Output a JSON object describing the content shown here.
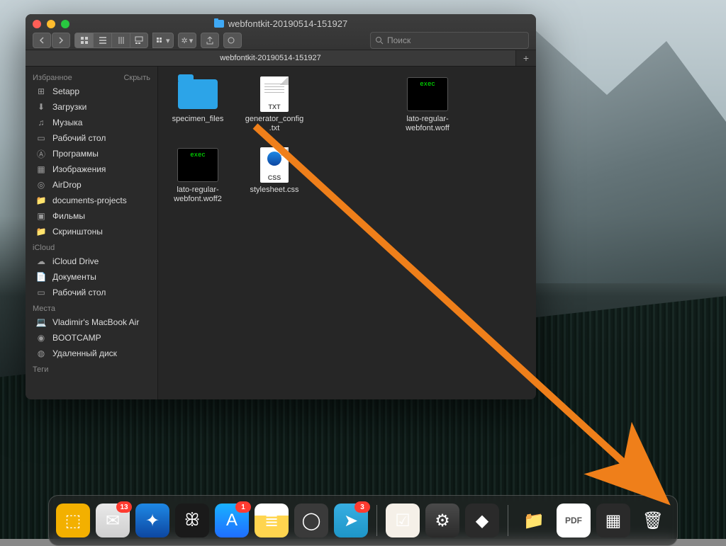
{
  "colors": {
    "accent": "#3fa9f5",
    "arrow": "#ef7f1a"
  },
  "window": {
    "title": "webfontkit-20190514-151927",
    "tab_label": "webfontkit-20190514-151927",
    "search_placeholder": "Поиск"
  },
  "toolbar": {
    "back": "‹",
    "forward": "›",
    "view_icon": "icon",
    "view_list": "list",
    "view_columns": "columns",
    "view_gallery": "gallery",
    "arrange": "arrange",
    "action": "action",
    "share": "share",
    "tags": "tags"
  },
  "sidebar": {
    "sections": [
      {
        "title": "Избранное",
        "hide": "Скрыть",
        "items": [
          {
            "id": "setapp",
            "label": "Setapp",
            "icon": "grid-icon"
          },
          {
            "id": "downloads",
            "label": "Загрузки",
            "icon": "download-icon"
          },
          {
            "id": "music",
            "label": "Музыка",
            "icon": "music-icon"
          },
          {
            "id": "desktop",
            "label": "Рабочий стол",
            "icon": "desktop-icon"
          },
          {
            "id": "apps",
            "label": "Программы",
            "icon": "apps-icon"
          },
          {
            "id": "pictures",
            "label": "Изображения",
            "icon": "pictures-icon"
          },
          {
            "id": "airdrop",
            "label": "AirDrop",
            "icon": "airdrop-icon"
          },
          {
            "id": "docsproj",
            "label": "documents-projects",
            "icon": "folder-icon"
          },
          {
            "id": "movies",
            "label": "Фильмы",
            "icon": "movies-icon"
          },
          {
            "id": "screenshots",
            "label": "Скринштоны",
            "icon": "folder-icon"
          }
        ]
      },
      {
        "title": "iCloud",
        "hide": "",
        "items": [
          {
            "id": "iclouddrive",
            "label": "iCloud Drive",
            "icon": "cloud-icon"
          },
          {
            "id": "documents",
            "label": "Документы",
            "icon": "document-icon"
          },
          {
            "id": "desktop2",
            "label": "Рабочий стол",
            "icon": "desktop-icon"
          }
        ]
      },
      {
        "title": "Места",
        "hide": "",
        "items": [
          {
            "id": "macbookair",
            "label": "Vladimir's MacBook Air",
            "icon": "laptop-icon"
          },
          {
            "id": "bootcamp",
            "label": "BOOTCAMP",
            "icon": "disk-icon"
          },
          {
            "id": "remotedisk",
            "label": "Удаленный диск",
            "icon": "disc-icon"
          }
        ]
      },
      {
        "title": "Теги",
        "hide": "",
        "items": []
      }
    ]
  },
  "files": [
    {
      "name": "specimen_files",
      "kind": "folder",
      "tag": ""
    },
    {
      "name": "generator_config.txt",
      "kind": "txt",
      "tag": "TXT"
    },
    {
      "name": "lato-regular-webfont.woff",
      "kind": "exec",
      "tag": "exec"
    },
    {
      "name": "lato-regular-webfont.woff2",
      "kind": "exec",
      "tag": "exec"
    },
    {
      "name": "stylesheet.css",
      "kind": "css",
      "tag": "CSS"
    }
  ],
  "annotation": {
    "from_file_index": 1,
    "target": "trash"
  },
  "dock": {
    "items": [
      {
        "id": "forklift",
        "label": "ForkLift",
        "glyph": "⬚",
        "cls": "d-forklift"
      },
      {
        "id": "mail",
        "label": "Mail",
        "glyph": "✉",
        "cls": "d-mail",
        "badge": "13"
      },
      {
        "id": "safari",
        "label": "Safari",
        "glyph": "✦",
        "cls": "d-safari"
      },
      {
        "id": "butterfly",
        "label": "App",
        "glyph": "ꕥ",
        "cls": "d-butterfly"
      },
      {
        "id": "appstore",
        "label": "App Store",
        "glyph": "A",
        "cls": "d-appstore",
        "badge": "1"
      },
      {
        "id": "notes",
        "label": "Notes",
        "glyph": "≣",
        "cls": "d-notes"
      },
      {
        "id": "logic",
        "label": "Logic",
        "glyph": "◯",
        "cls": "d-logic"
      },
      {
        "id": "telegram",
        "label": "Telegram",
        "glyph": "➤",
        "cls": "d-telegram",
        "badge": "3"
      }
    ],
    "items2": [
      {
        "id": "things",
        "label": "Things",
        "glyph": "☑",
        "cls": "d-things"
      },
      {
        "id": "settings",
        "label": "System Preferences",
        "glyph": "⚙",
        "cls": "d-settings"
      },
      {
        "id": "cleanmymac",
        "label": "CleanMyMac",
        "glyph": "◆",
        "cls": "d-cleanmymac"
      }
    ],
    "items3": [
      {
        "id": "dropbox",
        "label": "Dropbox",
        "glyph": "📁",
        "cls": "d-folder"
      },
      {
        "id": "pdf",
        "label": "PDF",
        "glyph": "PDF",
        "cls": "d-pdf"
      },
      {
        "id": "screens",
        "label": "Screenshots",
        "glyph": "▦",
        "cls": "d-figma"
      },
      {
        "id": "trash",
        "label": "Trash",
        "glyph": "🗑",
        "cls": "d-trash"
      }
    ]
  }
}
